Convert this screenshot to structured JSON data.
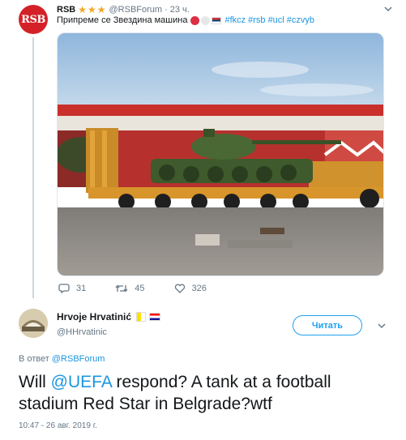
{
  "tweet1": {
    "avatar_text": "RSB",
    "name": "RSB",
    "stars": "★★★",
    "handle": "@RSBForum",
    "time": "23 ч.",
    "text": "Припреме се Звездина машина",
    "hashtags": [
      "#fkcz",
      "#rsb",
      "#ucl",
      "#czvyb"
    ],
    "reply_count": "31",
    "retweet_count": "45",
    "like_count": "326"
  },
  "tweet2": {
    "name": "Hrvoje Hrvatinić",
    "handle": "@HHrvatinic",
    "follow_label": "Читать",
    "reply_prefix": "В ответ",
    "reply_handle": "@RSBForum",
    "body_before": "Will ",
    "mention": "@UEFA",
    "body_after": "  respond? A tank at a football stadium Red Star in Belgrade?wtf",
    "timestamp": "10:47 - 26 авг. 2019 г."
  },
  "icons": {
    "reply": "reply-icon",
    "retweet": "retweet-icon",
    "like": "heart-icon",
    "caret": "chevron-down-icon"
  },
  "colors": {
    "link": "#1b95e0",
    "follow": "#1da1f2",
    "rsb_red": "#d42128",
    "muted": "#657786"
  }
}
